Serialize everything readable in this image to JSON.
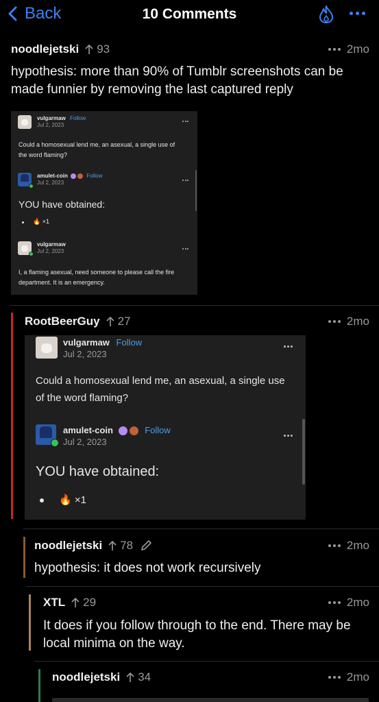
{
  "header": {
    "back_label": "Back",
    "title": "10 Comments",
    "accent_color": "#3b82f6"
  },
  "comments": [
    {
      "user": "noodlejetski",
      "score": "93",
      "time": "2mo",
      "text": "hypothesis: more than 90% of Tumblr screenshots can be made funnier by removing the last captured reply",
      "thread_color": "",
      "embed": {
        "posts": [
          {
            "user": "vulgarmaw",
            "follow": "Follow",
            "date": "Jul 2, 2023",
            "text": "Could a homosexual lend me, an asexual, a single use of the word flaming?"
          },
          {
            "user": "amulet-coin",
            "follow": "Follow",
            "date": "Jul 2, 2023",
            "text": "YOU have obtained:",
            "item": "🔥 ×1"
          },
          {
            "user": "vulgarmaw",
            "follow": "",
            "date": "Jul 2, 2023",
            "text": "I, a flaming asexual, need someone to please call the fire department. It is an emergency."
          }
        ]
      }
    },
    {
      "user": "RootBeerGuy",
      "score": "27",
      "time": "2mo",
      "text": "",
      "thread_color": "#c62828",
      "embed": {
        "posts": [
          {
            "user": "vulgarmaw",
            "follow": "Follow",
            "date": "Jul 2, 2023",
            "text": "Could a homosexual lend me, an asexual, a single use of the word flaming?"
          },
          {
            "user": "amulet-coin",
            "follow": "Follow",
            "date": "Jul 2, 2023",
            "text": "YOU have obtained:",
            "item": "🔥 ×1"
          }
        ]
      }
    },
    {
      "user": "noodlejetski",
      "score": "78",
      "time": "2mo",
      "text": "hypothesis: it does not work recursively",
      "thread_color": "#8a5a2b",
      "edited_icon": "pencil-icon"
    },
    {
      "user": "XTL",
      "score": "29",
      "time": "2mo",
      "text": "It does if you follow through to the end. There may be local minima on the way.",
      "thread_color": "#a9865a"
    },
    {
      "user": "noodlejetski",
      "score": "34",
      "time": "2mo",
      "text": "",
      "thread_color": "#2e7d4f"
    }
  ],
  "icons": {
    "back": "chevron-left-icon",
    "flame": "flame-icon",
    "more": "ellipsis-icon",
    "upvote": "arrow-up-icon"
  }
}
